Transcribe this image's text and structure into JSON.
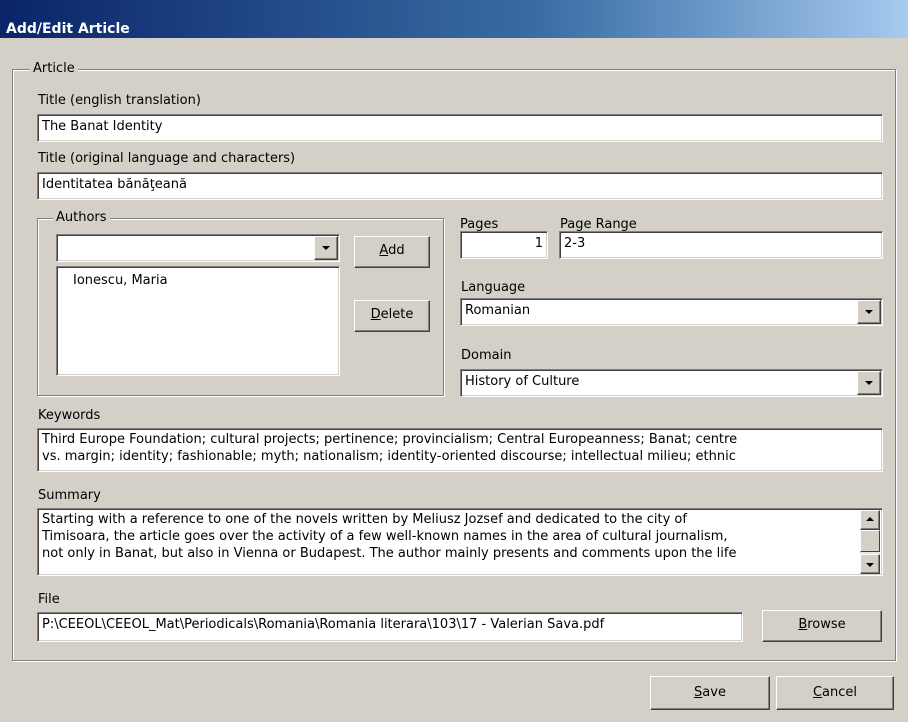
{
  "window": {
    "title": "Add/Edit Article"
  },
  "article_group": {
    "legend": "Article"
  },
  "title_english": {
    "label": "Title (english translation)",
    "value": "The Banat Identity"
  },
  "title_original": {
    "label": "Title (original language and characters)",
    "value": "Identitatea bănăţeană"
  },
  "authors": {
    "legend": "Authors",
    "combo_value": "",
    "items": [
      "Ionescu, Maria"
    ],
    "add_prefix": "",
    "add_key": "A",
    "add_rest": "dd",
    "delete_prefix": "",
    "delete_key": "D",
    "delete_rest": "elete"
  },
  "pages": {
    "label": "Pages",
    "value": "1"
  },
  "page_range": {
    "label": "Page Range",
    "value": "2-3"
  },
  "language": {
    "label": "Language",
    "value": "Romanian"
  },
  "domain": {
    "label": "Domain",
    "value": "History of Culture"
  },
  "keywords": {
    "label": "Keywords",
    "line1": "Third Europe Foundation; cultural projects;  pertinence; provincialism; Central Europeanness; Banat; centre",
    "line2": "vs. margin; identity; fashionable; myth; nationalism; identity-oriented discourse; intellectual milieu; ethnic"
  },
  "summary": {
    "label": "Summary",
    "line1": "Starting with a reference to one of the novels written by Meliusz Jozsef and dedicated to the city of",
    "line2": "Timisoara, the article goes over the activity of a few well-known names in the area of cultural journalism,",
    "line3": "not only in Banat, but also in Vienna or Budapest. The author mainly presents and comments upon the life"
  },
  "file": {
    "label": "File",
    "value": "P:\\CEEOL\\CEEOL_Mat\\Periodicals\\Romania\\Romania literara\\103\\17 - Valerian Sava.pdf",
    "browse_prefix": "",
    "browse_key": "B",
    "browse_rest": "rowse"
  },
  "buttons": {
    "save_prefix": "",
    "save_key": "S",
    "save_rest": "ave",
    "cancel_prefix": "",
    "cancel_key": "C",
    "cancel_rest": "ancel"
  }
}
